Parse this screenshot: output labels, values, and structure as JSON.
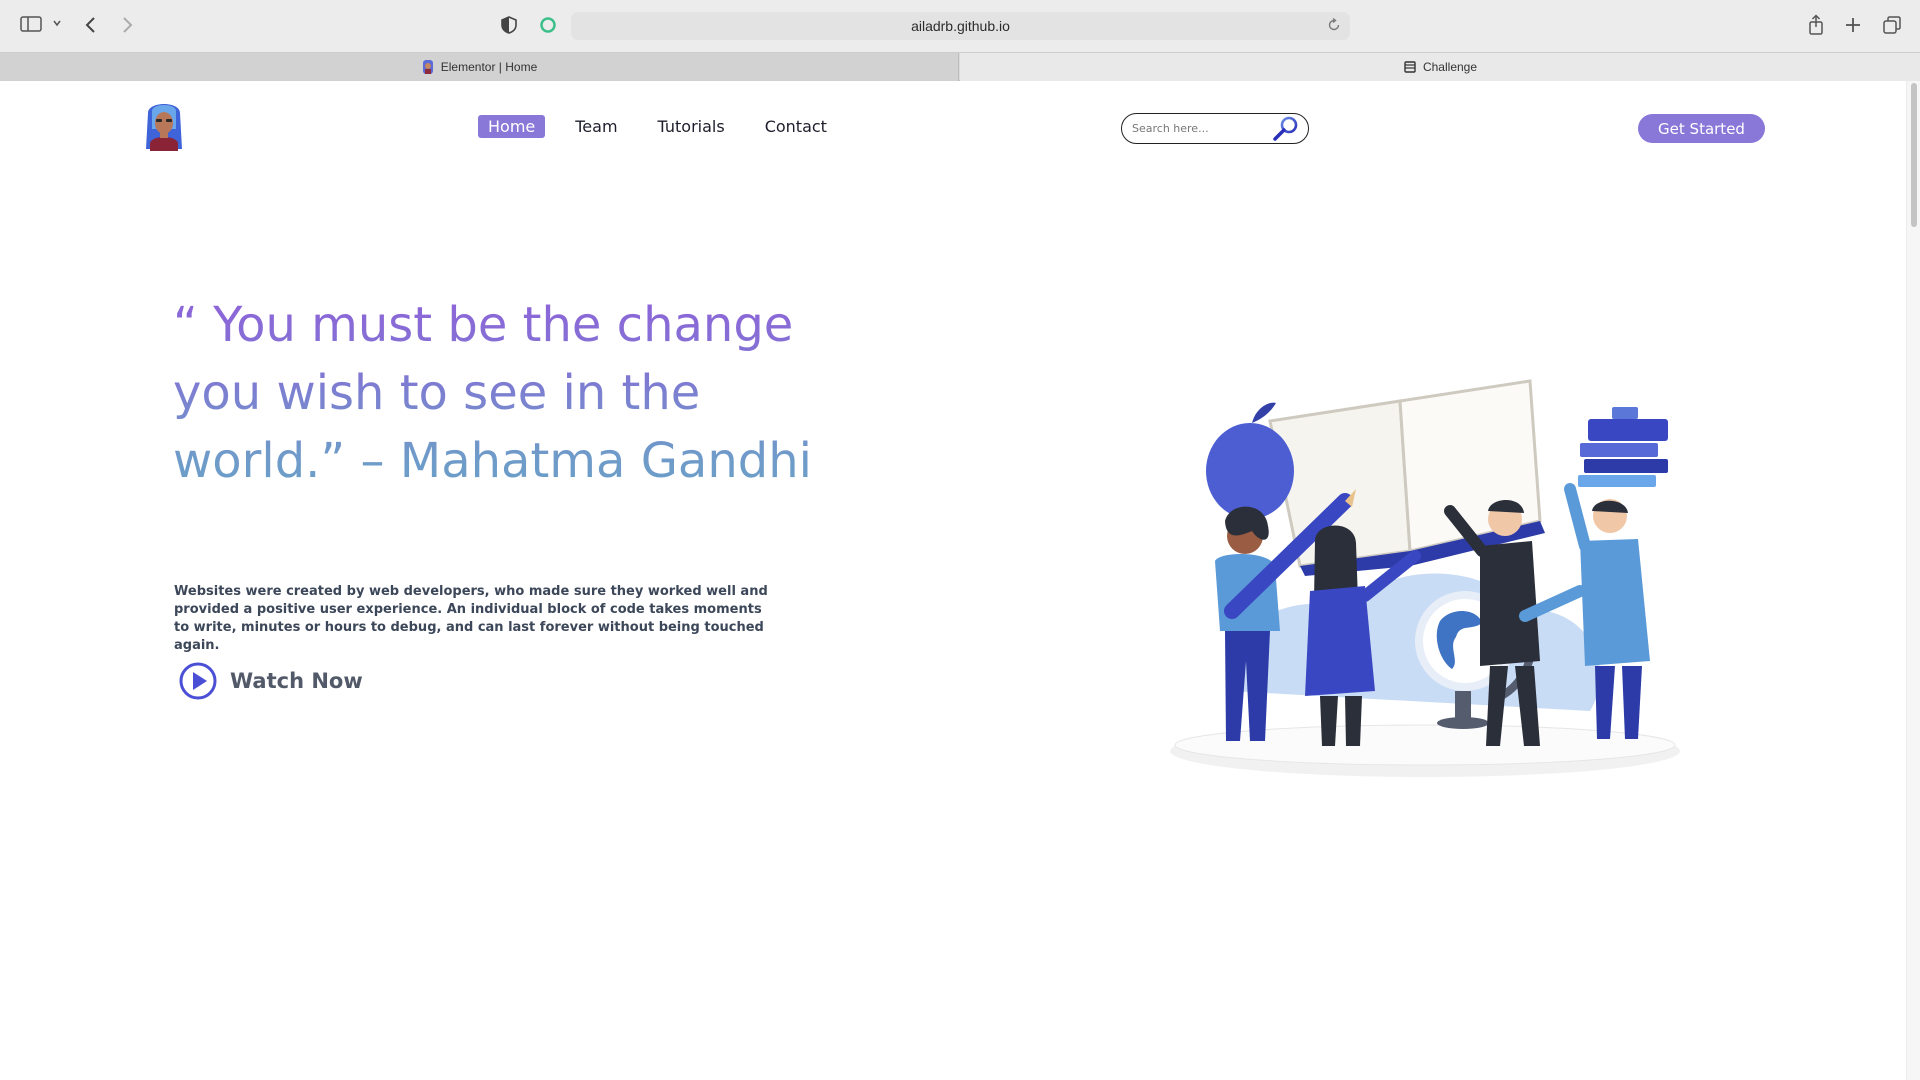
{
  "browser": {
    "url": "ailadrb.github.io",
    "tabs": [
      {
        "title": "Elementor | Home",
        "active": true
      },
      {
        "title": "Challenge",
        "active": false
      }
    ],
    "icons": [
      "sidebar-icon",
      "chevron-down-icon",
      "back-icon",
      "forward-icon",
      "privacy-shield-icon",
      "extension-icon",
      "reload-icon",
      "share-icon",
      "new-tab-icon",
      "tab-overview-icon"
    ]
  },
  "site": {
    "nav": [
      {
        "label": "Home",
        "active": true
      },
      {
        "label": "Team",
        "active": false
      },
      {
        "label": "Tutorials",
        "active": false
      },
      {
        "label": "Contact",
        "active": false
      }
    ],
    "search": {
      "placeholder": "Search here..."
    },
    "cta_label": "Get Started",
    "hero": {
      "quote": "“ You must be the change you wish to see in the world.” – Mahatma Gandhi",
      "description": "Websites were created by web developers, who made sure they worked well and provided a positive user experience. An individual block of code takes moments to write, minutes or hours to debug, and can last forever without being touched again.",
      "watch_label": "Watch Now"
    },
    "colors": {
      "accent": "#8a78d8",
      "quote_top": "#8f62d9",
      "quote_bottom": "#6aa0c7",
      "play_icon": "#4a4fd6",
      "text_dark": "#3c4759"
    }
  }
}
